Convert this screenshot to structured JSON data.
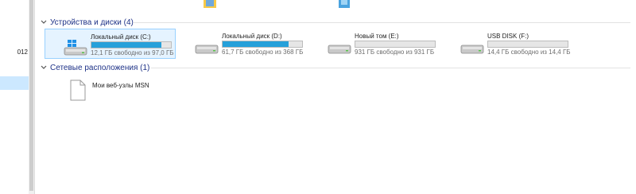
{
  "nav": {
    "partial_item_text": "012"
  },
  "groups": [
    {
      "label": "Устройства и диски (4)"
    },
    {
      "label": "Сетевые расположения (1)"
    }
  ],
  "drives": [
    {
      "name": "Локальный диск (C:)",
      "free": "12,1 ГБ свободно из 97,0 ГБ",
      "used_fraction": 0.875,
      "icon": "windows-drive-icon"
    },
    {
      "name": "Локальный диск (D:)",
      "free": "61,7 ГБ свободно из 368 ГБ",
      "used_fraction": 0.833,
      "icon": "hard-drive-icon"
    },
    {
      "name": "Новый том (E:)",
      "free": "931 ГБ свободно из 931 ГБ",
      "used_fraction": 0.0,
      "icon": "hard-drive-icon"
    },
    {
      "name": "USB DISK (F:)",
      "free": "14,4 ГБ свободно из 14,4 ГБ",
      "used_fraction": 0.0,
      "icon": "usb-drive-icon"
    }
  ],
  "network": [
    {
      "label": "Мои веб-узлы MSN",
      "icon": "document-icon"
    }
  ],
  "colors": {
    "group_header": "#1e3287",
    "bar_fill": "#26a0da",
    "selection_bg": "#e5f3ff",
    "selection_border": "#99d1ff"
  }
}
